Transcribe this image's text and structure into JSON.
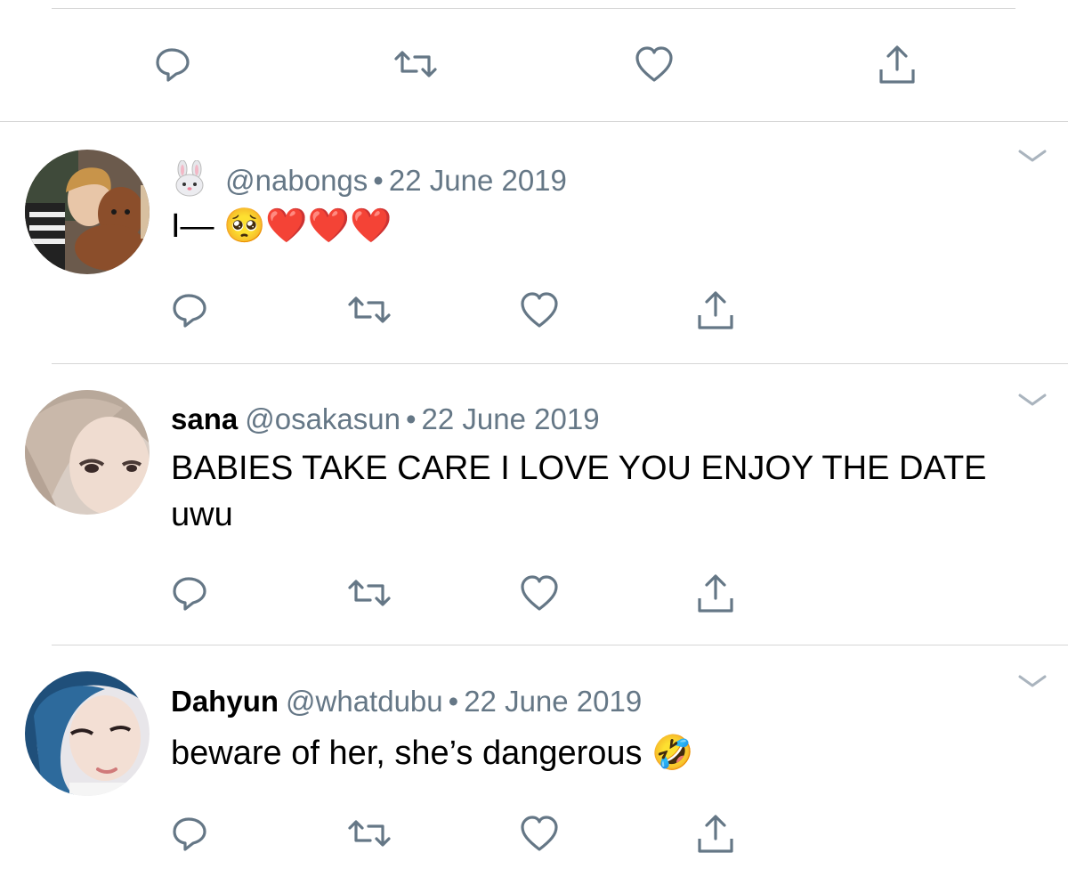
{
  "colors": {
    "icon": "#657786",
    "divider": "#d6d6d6",
    "text": "#000000",
    "muted": "#657786"
  },
  "top_actions": {
    "icons": [
      "reply-icon",
      "retweet-icon",
      "like-icon",
      "share-icon"
    ]
  },
  "tweets": [
    {
      "name": "",
      "name_prefix_icon": "rabbit-face-icon",
      "handle": "@nabongs",
      "separator": "•",
      "date": "22 June 2019",
      "text": "I— 🥺❤️❤️❤️"
    },
    {
      "name": "sana",
      "handle": "@osakasun",
      "separator": "•",
      "date": "22 June 2019",
      "text": "BABIES TAKE CARE I LOVE YOU ENJOY THE DATE uwu"
    },
    {
      "name": "Dahyun",
      "handle": "@whatdubu",
      "separator": "•",
      "date": "22 June 2019",
      "text": "beware of her, she’s dangerous 🤣"
    }
  ]
}
